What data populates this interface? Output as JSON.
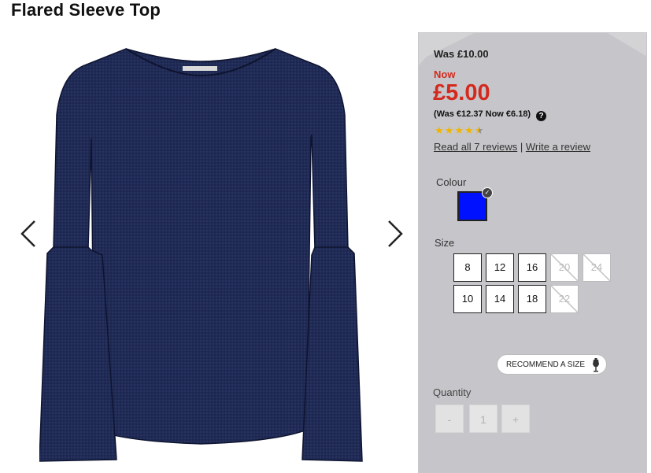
{
  "product": {
    "title": "Flared Sleeve Top"
  },
  "pricing": {
    "was": "Was £10.00",
    "now_label": "Now",
    "now_price": "£5.00",
    "euro": "(Was €12.37 Now €6.18)",
    "help_icon": "?"
  },
  "rating": {
    "stars": 4.5,
    "read_reviews": "Read all 7 reviews",
    "separator": "|",
    "write_review": "Write a review"
  },
  "colour": {
    "label": "Colour",
    "selected_color": "#0011ff",
    "check": "✓"
  },
  "size": {
    "label": "Size",
    "options": [
      {
        "label": "8",
        "available": true
      },
      {
        "label": "12",
        "available": true
      },
      {
        "label": "16",
        "available": true
      },
      {
        "label": "20",
        "available": false
      },
      {
        "label": "24",
        "available": false
      },
      {
        "label": "10",
        "available": true
      },
      {
        "label": "14",
        "available": true
      },
      {
        "label": "18",
        "available": true
      },
      {
        "label": "22",
        "available": false
      }
    ]
  },
  "recommend": {
    "label": "RECOMMEND A SIZE"
  },
  "quantity": {
    "label": "Quantity",
    "minus": "-",
    "value": "1",
    "plus": "+"
  },
  "colors": {
    "price_red": "#d42a1e",
    "garment": "#1c2447"
  }
}
